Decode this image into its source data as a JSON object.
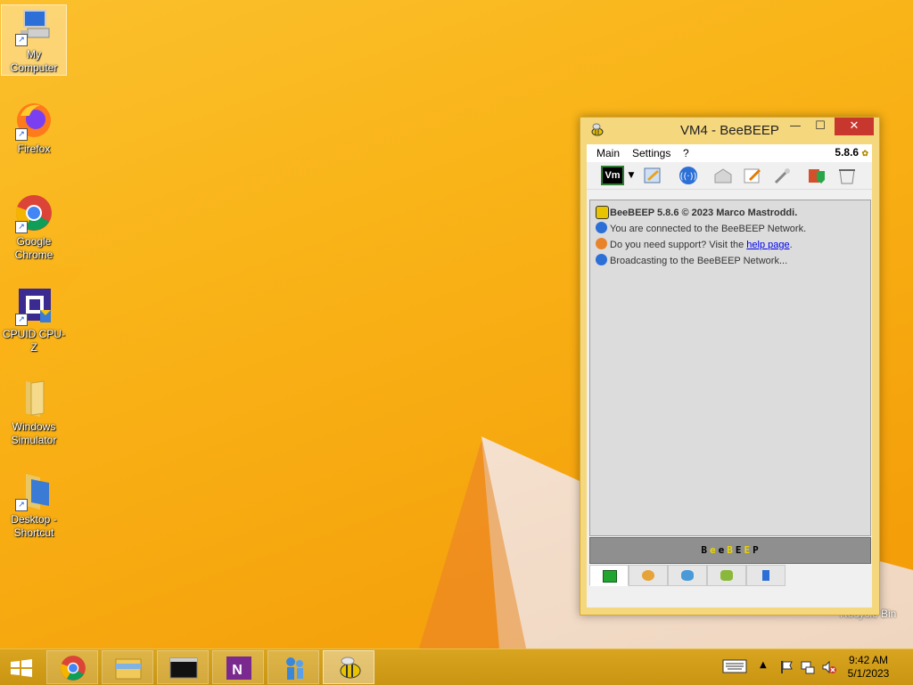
{
  "desktop": {
    "icons": [
      {
        "label": "My Computer",
        "icon": "computer-icon"
      },
      {
        "label": "Firefox",
        "icon": "firefox-icon"
      },
      {
        "label": "Google Chrome",
        "icon": "chrome-icon"
      },
      {
        "label": "CPUID CPU-Z",
        "icon": "cpuz-icon"
      },
      {
        "label": "Windows Simulator",
        "icon": "folder-icon"
      },
      {
        "label": "Desktop - Shortcut",
        "icon": "folder-shortcut-icon"
      }
    ],
    "recycle_bin_label": "Recycle Bin"
  },
  "window": {
    "title": "VM4 - BeeBEEP",
    "menu": [
      "Main",
      "Settings",
      "?"
    ],
    "version": "5.8.6",
    "status_badge": "Vm",
    "log": [
      {
        "text": "BeeBEEP 5.8.6 © 2023 Marco Mastroddi.",
        "bold": true
      },
      {
        "text": "You are connected to the BeeBEEP Network."
      },
      {
        "prefix": "Do you need support? Visit the ",
        "link": "help page",
        "suffix": "."
      },
      {
        "text": "Broadcasting to the BeeBEEP Network..."
      }
    ],
    "banner": [
      "B",
      "e",
      "e",
      "B",
      "E",
      "E",
      "P"
    ],
    "banner_colors": [
      "#000000",
      "#e8d400",
      "#000000",
      "#e8d400",
      "#000000",
      "#e8d400",
      "#000000"
    ],
    "tabs": [
      "users-tab",
      "groups-tab",
      "chats-tab",
      "plugins-tab",
      "files-tab",
      "pin-tab"
    ]
  },
  "taskbar": {
    "apps": [
      "start-icon",
      "chrome-icon",
      "file-explorer-icon",
      "terminal-icon",
      "onenote-icon",
      "network-icon",
      "beebeep-icon"
    ],
    "time": "9:42 AM",
    "date": "5/1/2023"
  },
  "colors": {
    "accent": "#f9b418",
    "window_frame": "#f5d77e",
    "close_button": "#c8372d",
    "link": "#0000ee"
  }
}
